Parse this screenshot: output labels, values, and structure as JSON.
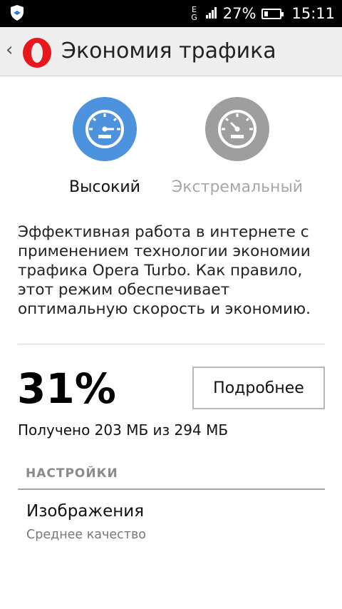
{
  "status_bar": {
    "network_top": "E",
    "network_label": "G",
    "battery_percent": "27%",
    "battery_level": 0.27,
    "time": "15:11"
  },
  "app_bar": {
    "title": "Экономия трафика",
    "logo_icon": "opera-logo-icon",
    "brand_color": "#e8171d"
  },
  "modes": [
    {
      "label": "Высокий",
      "icon": "speedometer-icon",
      "color": "#4d92dd",
      "selected": true
    },
    {
      "label": "Экстремальный",
      "icon": "speedometer-icon",
      "color": "#9e9e9e",
      "selected": false
    }
  ],
  "description": "Эффективная работа в интернете с применением технологии экономии трафика Opera Turbo. Как правило, этот режим обеспечивает оптимальную скорость и экономию.",
  "stats": {
    "percent": "31%",
    "details_button": "Подробнее",
    "received": "Получено 203 МБ из 294 МБ"
  },
  "settings": {
    "header": "НАСТРОЙКИ",
    "items": [
      {
        "title": "Изображения",
        "subtitle": "Среднее качество"
      }
    ]
  }
}
